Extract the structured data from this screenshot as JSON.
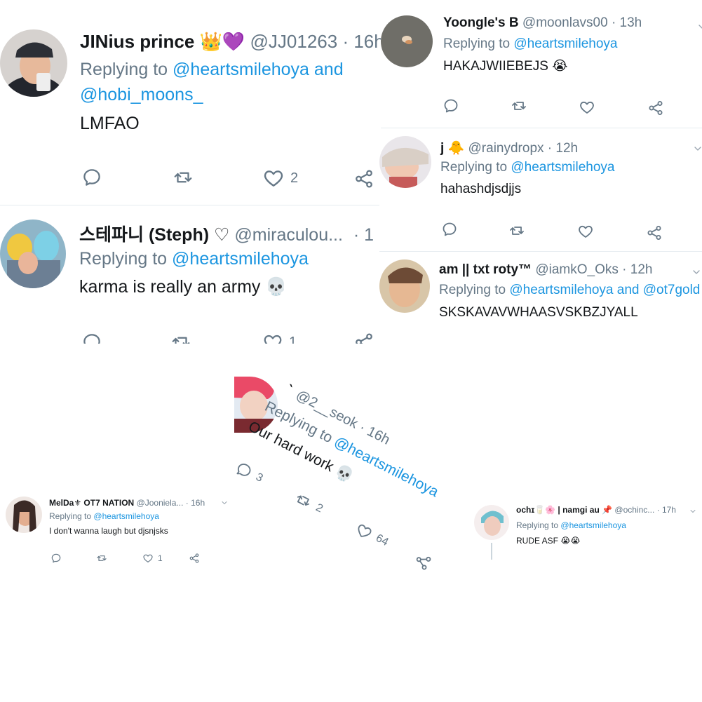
{
  "colors": {
    "link": "#1b95e0",
    "secondary": "#657786",
    "text": "#14171a",
    "divider": "#e6ecf0"
  },
  "icons": {
    "reply": "reply-icon",
    "retweet": "retweet-icon",
    "like": "heart-icon",
    "share": "share-icon",
    "menu": "chevron-down-icon"
  },
  "tweets": [
    {
      "name": "JINius prince",
      "name_emoji": "👑💜",
      "handle": "@JJ01263",
      "time": "· 16h",
      "replying_label": "Replying to",
      "reply_to_1": "@heartsmilehoya",
      "and": "and",
      "reply_to_2": "@hobi_moons_",
      "text": "LMFAO",
      "likes": "2"
    },
    {
      "name": "스테파니 (Steph) ♡",
      "handle": "@miraculou...",
      "time": "· 1",
      "replying_label": "Replying to",
      "reply_to": "@heartsmilehoya",
      "text": "karma is really an army 💀",
      "likes": "1"
    },
    {
      "name": "Yoongle's B",
      "handle": "@moonlavs00",
      "time": "· 13h",
      "replying_label": "Replying to",
      "reply_to": "@heartsmilehoya",
      "text": "HAKAJWIIEBEJS 😭"
    },
    {
      "name": "j",
      "name_emoji": "🐥",
      "handle": "@rainydropx",
      "time": "· 12h",
      "replying_label": "Replying to",
      "reply_to": "@heartsmilehoya",
      "text": "hahashdjsdjjs"
    },
    {
      "name": "am || txt roty™",
      "handle": "@iamkO_Oks",
      "time": "· 12h",
      "replying_label": "Replying to",
      "reply_to_1": "@heartsmilehoya",
      "and": "and",
      "reply_to_2": "@ot7gold",
      "text": "SKSKAVAVWHAASVSKBZJYALL"
    },
    {
      "name": "`",
      "handle": "@2__seok",
      "time": "· 16h",
      "replying_label": "Replying to",
      "reply_to": "@heartsmilehoya",
      "text": "Our hard work 💀",
      "replies": "3",
      "retweets": "2",
      "likes": "64"
    },
    {
      "name": "MelDa⚜ OT7 NATION",
      "handle": "@Jooniela...",
      "time": "· 16h",
      "replying_label": "Replying to",
      "reply_to": "@heartsmilehoya",
      "text": "I don't wanna laugh but djsnjsks",
      "likes": "1"
    },
    {
      "name": "ochɪ🥛🌸 | namgi au 📌",
      "handle": "@ochinc...",
      "time": "· 17h",
      "replying_label": "Replying to",
      "reply_to": "@heartsmilehoya",
      "text": "RUDE ASF 😭😭"
    }
  ]
}
